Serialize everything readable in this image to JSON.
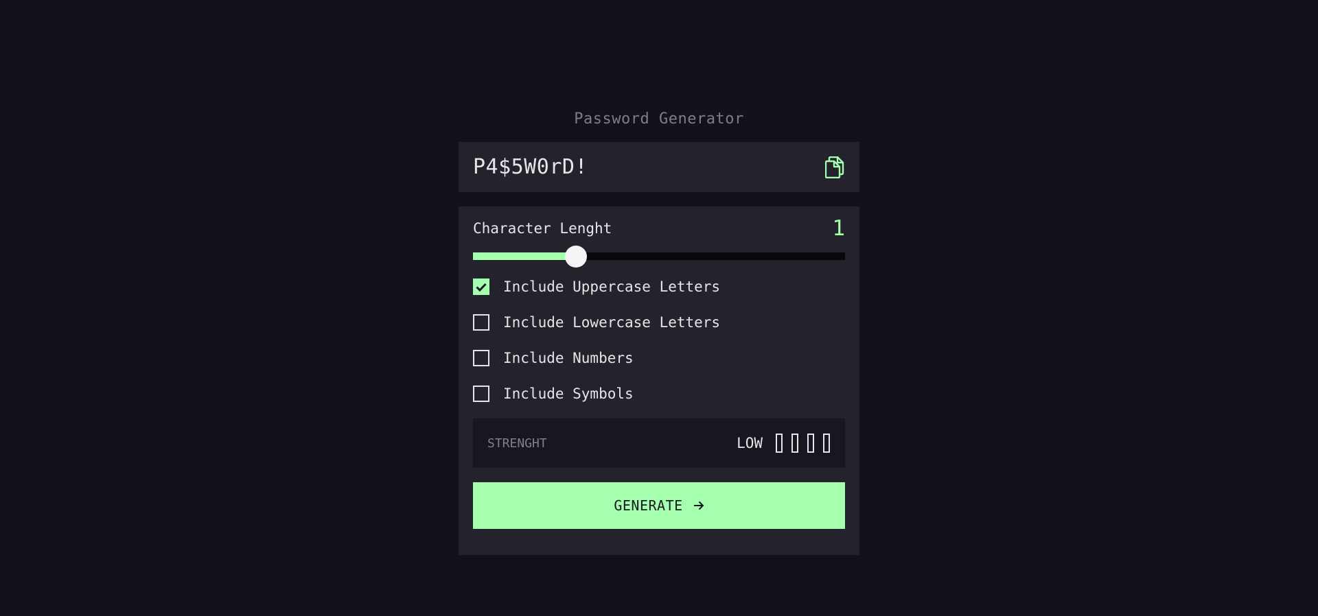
{
  "app": {
    "title": "Password Generator"
  },
  "password": {
    "value": "P4$5W0rD!",
    "copy_icon": "copy-icon"
  },
  "length": {
    "label": "Character Lenght",
    "value": "1",
    "slider_fraction": 0.276
  },
  "options": [
    {
      "label": "Include Uppercase Letters",
      "checked": true
    },
    {
      "label": "Include Lowercase Letters",
      "checked": false
    },
    {
      "label": "Include Numbers",
      "checked": false
    },
    {
      "label": "Include Symbols",
      "checked": false
    }
  ],
  "strength": {
    "label": "STRENGHT",
    "level": "LOW",
    "filled_bars": 0,
    "total_bars": 4
  },
  "generate": {
    "label": "GENERATE",
    "icon": "arrow-right-icon"
  },
  "colors": {
    "accent": "#a4ffaf",
    "background": "#12121a",
    "panel": "#24232c",
    "strength_bg": "#18171f",
    "muted_text": "#817d92",
    "text": "#e6e5ea"
  }
}
